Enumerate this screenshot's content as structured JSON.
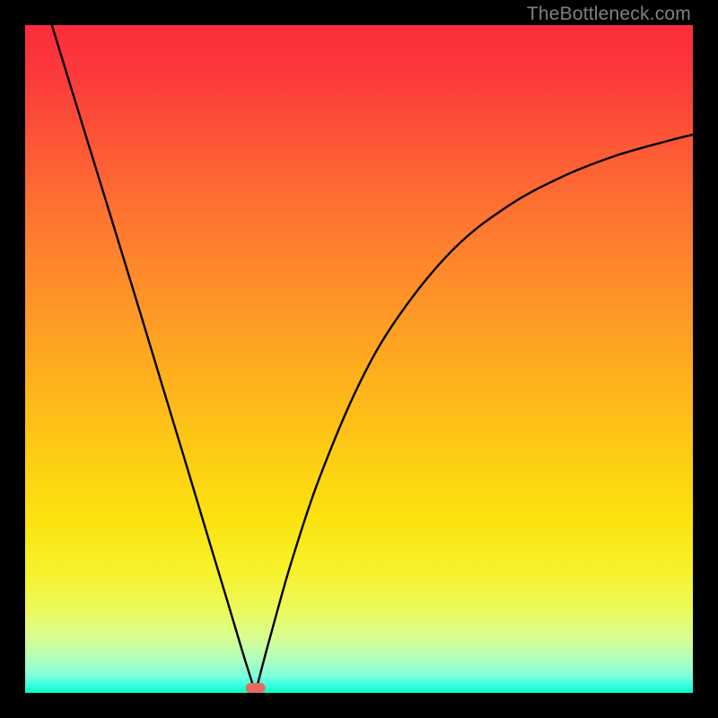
{
  "watermark": "TheBottleneck.com",
  "chart_data": {
    "type": "line",
    "title": "",
    "xlabel": "",
    "ylabel": "",
    "xlim": [
      0,
      1
    ],
    "ylim": [
      0,
      1
    ],
    "vertex_x": 0.345,
    "marker": {
      "x_frac": 0.345,
      "color": "#e86a5e"
    },
    "gradient_stops": [
      {
        "pos": 0.0,
        "color": "#fc2c3c"
      },
      {
        "pos": 0.5,
        "color": "#feb31c"
      },
      {
        "pos": 0.82,
        "color": "#f6f22d"
      },
      {
        "pos": 1.0,
        "color": "#03ffbe"
      }
    ],
    "series": [
      {
        "name": "curve",
        "color": "#000000",
        "x": [
          0.04,
          0.08,
          0.12,
          0.16,
          0.2,
          0.24,
          0.28,
          0.3,
          0.32,
          0.33,
          0.34,
          0.345,
          0.35,
          0.36,
          0.38,
          0.4,
          0.44,
          0.5,
          0.56,
          0.64,
          0.72,
          0.8,
          0.88,
          0.96,
          1.0
        ],
        "y": [
          1.0,
          0.87,
          0.74,
          0.61,
          0.478,
          0.346,
          0.213,
          0.147,
          0.08,
          0.047,
          0.015,
          0.0,
          0.02,
          0.058,
          0.131,
          0.2,
          0.32,
          0.462,
          0.565,
          0.663,
          0.727,
          0.771,
          0.803,
          0.826,
          0.836
        ]
      }
    ]
  }
}
